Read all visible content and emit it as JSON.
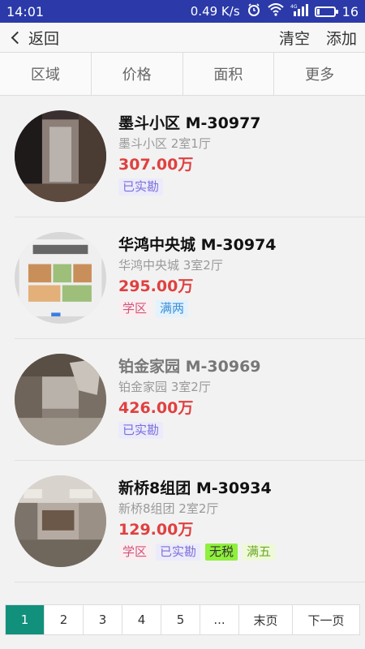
{
  "status_bar": {
    "time": "14:01",
    "speed": "0.49 K/s",
    "network": "4G",
    "battery": "16",
    "battery_level": 0.16,
    "icons": [
      "alarm-icon",
      "wifi-icon",
      "signal-icon",
      "battery-icon"
    ]
  },
  "navbar": {
    "back_label": "返回",
    "clear_label": "清空",
    "add_label": "添加"
  },
  "filters": [
    "区域",
    "价格",
    "面积",
    "更多"
  ],
  "listings": [
    {
      "title": "墨斗小区 M-30977",
      "subtitle": "墨斗小区 2室1厅",
      "price": "307.00万",
      "title_style": "dark",
      "tags": [
        {
          "text": "已实勘",
          "style": "purple"
        }
      ]
    },
    {
      "title": "华鸿中央城 M-30974",
      "subtitle": "华鸿中央城 3室2厅",
      "price": "295.00万",
      "title_style": "dark",
      "tags": [
        {
          "text": "学区",
          "style": "pink"
        },
        {
          "text": "满两",
          "style": "blue"
        }
      ]
    },
    {
      "title": "铂金家园 M-30969",
      "subtitle": "铂金家园 3室2厅",
      "price": "426.00万",
      "title_style": "grey",
      "tags": [
        {
          "text": "已实勘",
          "style": "purple"
        }
      ]
    },
    {
      "title": "新桥8组团 M-30934",
      "subtitle": "新桥8组团 2室2厅",
      "price": "129.00万",
      "title_style": "dark",
      "tags": [
        {
          "text": "学区",
          "style": "pink"
        },
        {
          "text": "已实勘",
          "style": "purple"
        },
        {
          "text": "无税",
          "style": "green"
        },
        {
          "text": "满五",
          "style": "lime"
        }
      ]
    }
  ],
  "pagination": {
    "pages": [
      "1",
      "2",
      "3",
      "4",
      "5",
      "...",
      "末页",
      "下一页"
    ],
    "active": "1"
  },
  "colors": {
    "status_bar": "#2b3aa8",
    "price": "#e04040",
    "active_page": "#11907c"
  }
}
